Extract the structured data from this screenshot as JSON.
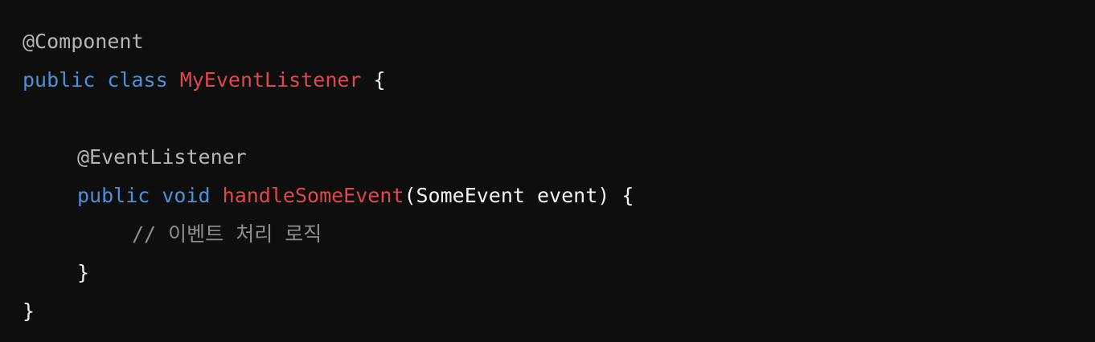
{
  "code": {
    "line1": {
      "annotation": "@Component"
    },
    "line2": {
      "kw_public": "public",
      "kw_class": "class",
      "class_name": "MyEventListener",
      "brace_open": "{"
    },
    "line4": {
      "annotation": "@EventListener"
    },
    "line5": {
      "kw_public": "public",
      "kw_void": "void",
      "method_name": "handleSomeEvent",
      "params": "(SomeEvent event) {"
    },
    "line6": {
      "comment": "// 이벤트 처리 로직"
    },
    "line7": {
      "brace_close": "}"
    },
    "line8": {
      "brace_close": "}"
    }
  },
  "colors": {
    "background": "#0e0e0e",
    "keyword": "#4e90d6",
    "identifier": "#e0464b",
    "annotation": "#b5b5b5",
    "comment": "#8e8e8e",
    "text": "#f2f2f2"
  }
}
